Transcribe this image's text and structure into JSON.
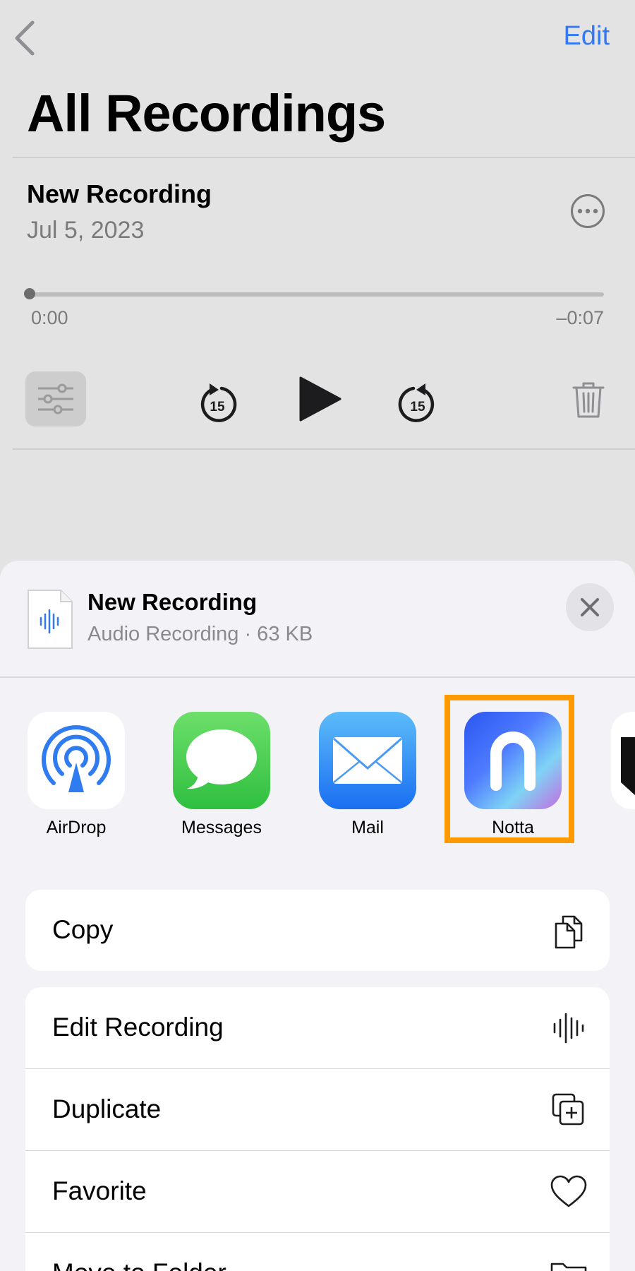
{
  "header": {
    "edit_label": "Edit",
    "title": "All Recordings"
  },
  "recording": {
    "title": "New Recording",
    "date": "Jul 5, 2023",
    "elapsed": "0:00",
    "remaining": "–0:07",
    "skip_seconds": "15",
    "progress": 0
  },
  "share_sheet": {
    "file_title": "New Recording",
    "file_subtitle": "Audio Recording · 63 KB",
    "apps": [
      {
        "label": "AirDrop",
        "icon": "airdrop-icon"
      },
      {
        "label": "Messages",
        "icon": "messages-icon"
      },
      {
        "label": "Mail",
        "icon": "mail-icon"
      },
      {
        "label": "Notta",
        "icon": "notta-app-icon",
        "highlighted": true,
        "highlight_color": "#ff9a00"
      }
    ],
    "actions_group1": [
      {
        "label": "Copy",
        "icon": "copy-icon"
      }
    ],
    "actions_group2": [
      {
        "label": "Edit Recording",
        "icon": "waveform-icon"
      },
      {
        "label": "Duplicate",
        "icon": "duplicate-icon"
      },
      {
        "label": "Favorite",
        "icon": "heart-icon"
      },
      {
        "label": "Move to Folder",
        "icon": "folder-icon"
      }
    ]
  },
  "colors": {
    "accent": "#3478f6",
    "highlight": "#ff9a00",
    "background_dimmed": "#e3e3e3",
    "sheet_bg": "#f2f2f7"
  }
}
